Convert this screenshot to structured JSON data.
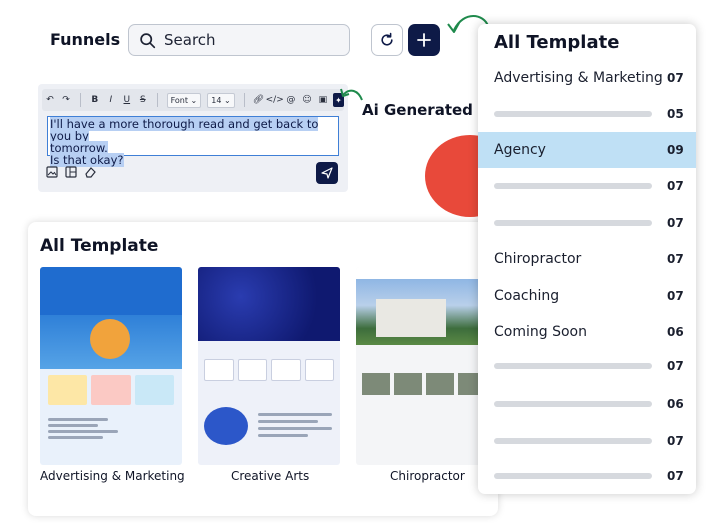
{
  "header": {
    "title": "Funnels",
    "search_placeholder": "Search"
  },
  "editor": {
    "toolbar": {
      "font_label": "Font",
      "size_label": "14"
    },
    "text_line1": "I'll have a more thorough read and get back to you by",
    "text_line2": "tomorrow.",
    "text_line3": "Is that okay?"
  },
  "ai_label": "Ai Generated",
  "templates": {
    "heading": "All Template",
    "cards": [
      {
        "label": "Advertising & Marketing"
      },
      {
        "label": "Creative Arts"
      },
      {
        "label": "Chiropractor"
      }
    ]
  },
  "dropdown": {
    "title": "All Template",
    "items": [
      {
        "label": "Advertising & Marketing",
        "count": "07",
        "placeholder": false,
        "selected": false
      },
      {
        "label": "",
        "count": "05",
        "placeholder": true,
        "selected": false
      },
      {
        "label": "Agency",
        "count": "09",
        "placeholder": false,
        "selected": true
      },
      {
        "label": "",
        "count": "07",
        "placeholder": true,
        "selected": false
      },
      {
        "label": "",
        "count": "07",
        "placeholder": true,
        "selected": false
      },
      {
        "label": "Chiropractor",
        "count": "07",
        "placeholder": false,
        "selected": false
      },
      {
        "label": "Coaching",
        "count": "07",
        "placeholder": false,
        "selected": false
      },
      {
        "label": "Coming Soon",
        "count": "06",
        "placeholder": false,
        "selected": false
      },
      {
        "label": "",
        "count": "07",
        "placeholder": true,
        "selected": false
      },
      {
        "label": "",
        "count": "06",
        "placeholder": true,
        "selected": false
      },
      {
        "label": "",
        "count": "07",
        "placeholder": true,
        "selected": false
      },
      {
        "label": "",
        "count": "07",
        "placeholder": true,
        "selected": false
      }
    ]
  },
  "colors": {
    "accent_navy": "#0e1a47",
    "arrow_green": "#1f8a4c",
    "selected_bg": "#bfe0f5",
    "decor_red": "#e8493a"
  },
  "icons": [
    "search-icon",
    "refresh-icon",
    "plus-icon",
    "send-icon",
    "arrow-icon"
  ]
}
